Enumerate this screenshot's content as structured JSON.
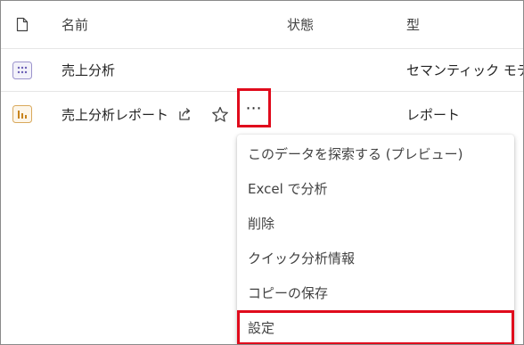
{
  "header": {
    "col_icon": "file-icon",
    "col_name": "名前",
    "col_status": "状態",
    "col_type": "型"
  },
  "rows": [
    {
      "icon": "semantic-model-icon",
      "name": "売上分析",
      "status": "",
      "type": "セマンティック モデル"
    },
    {
      "icon": "report-icon",
      "name": "売上分析レポート",
      "status": "",
      "type": "レポート"
    }
  ],
  "actions": {
    "share_icon": "share-icon",
    "favorite_icon": "star-icon",
    "more_label": "⋯"
  },
  "context_menu": {
    "items": [
      "このデータを探索する (プレビュー)",
      "Excel で分析",
      "削除",
      "クイック分析情報",
      "コピーの保存",
      "設定"
    ],
    "highlighted_index": 5
  },
  "colors": {
    "highlight_border": "#e00b1c",
    "report_icon": "#c8841d",
    "semantic_icon": "#6b5fb5"
  }
}
